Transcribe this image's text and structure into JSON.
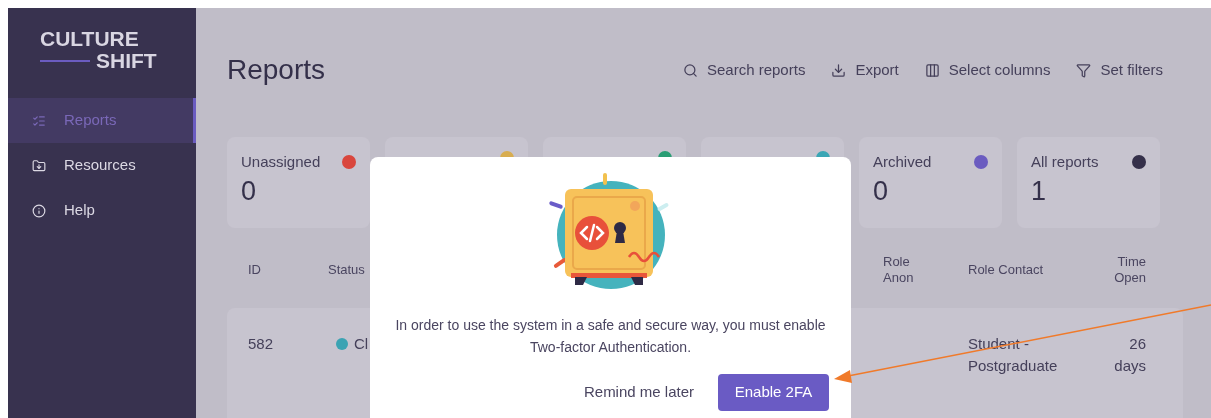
{
  "sidebar": {
    "logo": {
      "line1": "CULTURE",
      "line2": "SHIFT"
    },
    "items": [
      {
        "label": "Reports",
        "selected": true
      },
      {
        "label": "Resources",
        "selected": false
      },
      {
        "label": "Help",
        "selected": false
      }
    ]
  },
  "page": {
    "title": "Reports",
    "actions": [
      "Search reports",
      "Export",
      "Select columns",
      "Set filters"
    ]
  },
  "status_cards": [
    {
      "label": "Unassigned",
      "count": "0",
      "color": "#d9463d"
    },
    {
      "color": "#d8ad50"
    },
    {
      "color": "#2a9d74"
    },
    {
      "color": "#3aa6b5"
    },
    {
      "label": "Archived",
      "count": "0",
      "color": "#6b5cc0"
    },
    {
      "label": "All reports",
      "count": "1",
      "color": "#35304a"
    }
  ],
  "table": {
    "columns": [
      "ID",
      "Status",
      "Role Anon",
      "Role Contact",
      "Time Open"
    ],
    "rows": [
      {
        "id": "582",
        "status": "Cl",
        "color": "#3ba3b3",
        "role_contact": "Student - Postgraduate",
        "time_open": "26 days"
      }
    ]
  },
  "modal": {
    "message": "In order to use the system in a safe and secure way, you must enable Two-factor Authentication.",
    "secondary_button": "Remind me later",
    "primary_button": "Enable 2FA"
  }
}
